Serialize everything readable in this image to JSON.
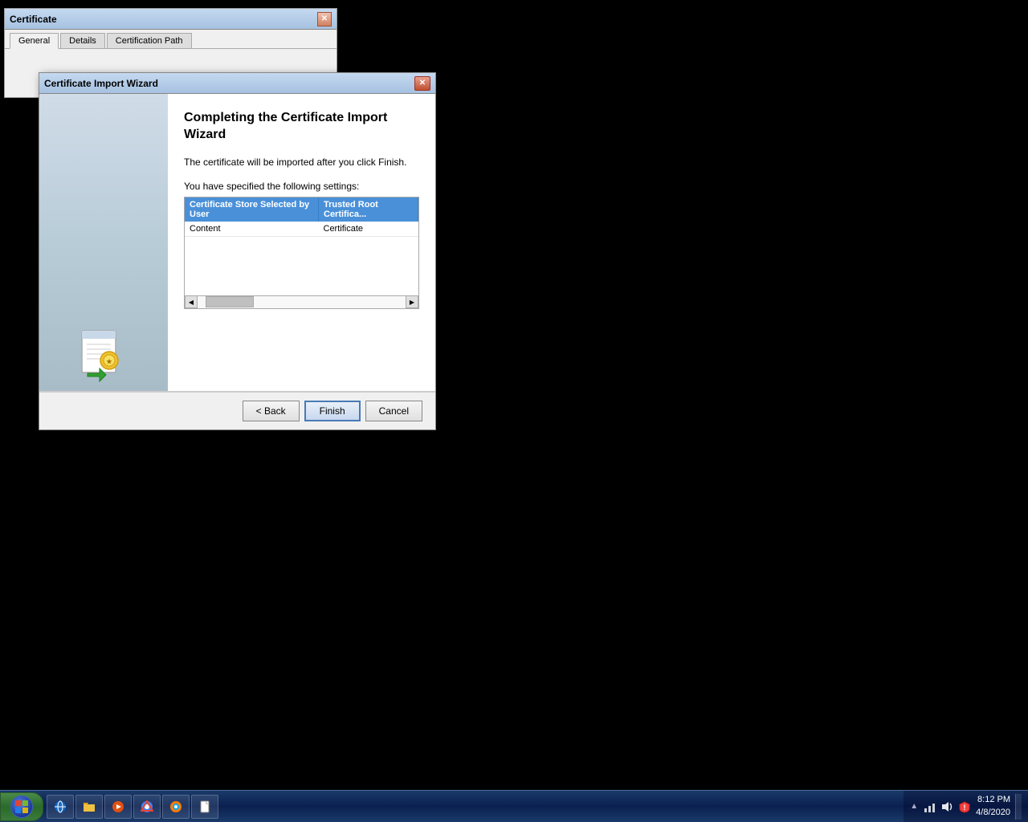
{
  "desktop": {
    "background_color": "#000000"
  },
  "cert_window": {
    "title": "Certificate",
    "tabs": [
      {
        "label": "General",
        "active": true
      },
      {
        "label": "Details",
        "active": false
      },
      {
        "label": "Certification Path",
        "active": false
      }
    ]
  },
  "wizard_window": {
    "title": "Certificate Import Wizard",
    "heading": "Completing the Certificate Import Wizard",
    "description": "The certificate will be imported after you click Finish.",
    "settings_label": "You have specified the following settings:",
    "table": {
      "columns": [
        "Certificate Store Selected by User",
        "Trusted Root Certifica..."
      ],
      "rows": [
        {
          "col1": "Content",
          "col2": "Certificate",
          "selected": false
        }
      ]
    },
    "buttons": {
      "back": "< Back",
      "finish": "Finish",
      "cancel": "Cancel"
    }
  },
  "taskbar": {
    "start_label": "Start",
    "items": [],
    "clock_time": "8:12 PM",
    "clock_date": "4/8/2020",
    "tray_icons": [
      "expand-icon",
      "network-icon",
      "volume-icon",
      "security-icon"
    ]
  }
}
